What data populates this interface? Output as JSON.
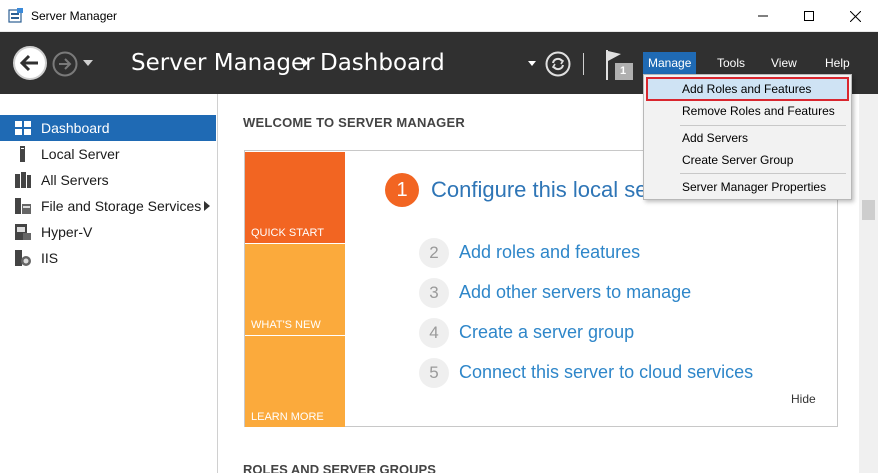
{
  "window": {
    "title": "Server Manager",
    "icon": "server-manager-icon"
  },
  "header": {
    "breadcrumb": [
      "Server Manager",
      "Dashboard"
    ],
    "menus": [
      "Manage",
      "Tools",
      "View",
      "Help"
    ],
    "active_menu": "Manage",
    "notification_count": "1"
  },
  "sidebar": {
    "items": [
      {
        "label": "Dashboard",
        "icon": "dashboard-icon",
        "active": true
      },
      {
        "label": "Local Server",
        "icon": "local-server-icon"
      },
      {
        "label": "All Servers",
        "icon": "all-servers-icon"
      },
      {
        "label": "File and Storage Services",
        "icon": "file-storage-icon",
        "has_submenu": true
      },
      {
        "label": "Hyper-V",
        "icon": "hyper-v-icon"
      },
      {
        "label": "IIS",
        "icon": "iis-icon"
      }
    ]
  },
  "main": {
    "welcome_heading": "WELCOME TO SERVER MANAGER",
    "tiles": [
      "QUICK START",
      "WHAT'S NEW",
      "LEARN MORE"
    ],
    "step_one": {
      "number": "1",
      "label": "Configure this local se"
    },
    "steps": [
      {
        "number": "2",
        "label": "Add roles and features"
      },
      {
        "number": "3",
        "label": "Add other servers to manage"
      },
      {
        "number": "4",
        "label": "Create a server group"
      },
      {
        "number": "5",
        "label": "Connect this server to cloud services"
      }
    ],
    "hide_label": "Hide",
    "roles_heading": "ROLES AND SERVER GROUPS"
  },
  "manage_menu": {
    "items": [
      "Add Roles and Features",
      "Remove Roles and Features",
      "Add Servers",
      "Create Server Group",
      "Server Manager Properties"
    ],
    "highlighted": "Add Roles and Features"
  },
  "colors": {
    "header_bg": "#303030",
    "accent_blue": "#1f6ab4",
    "quick_start_orange": "#f26522",
    "tile_amber": "#fbaa3c",
    "link_blue": "#2e86c9",
    "highlight_outline": "#d9262e"
  }
}
